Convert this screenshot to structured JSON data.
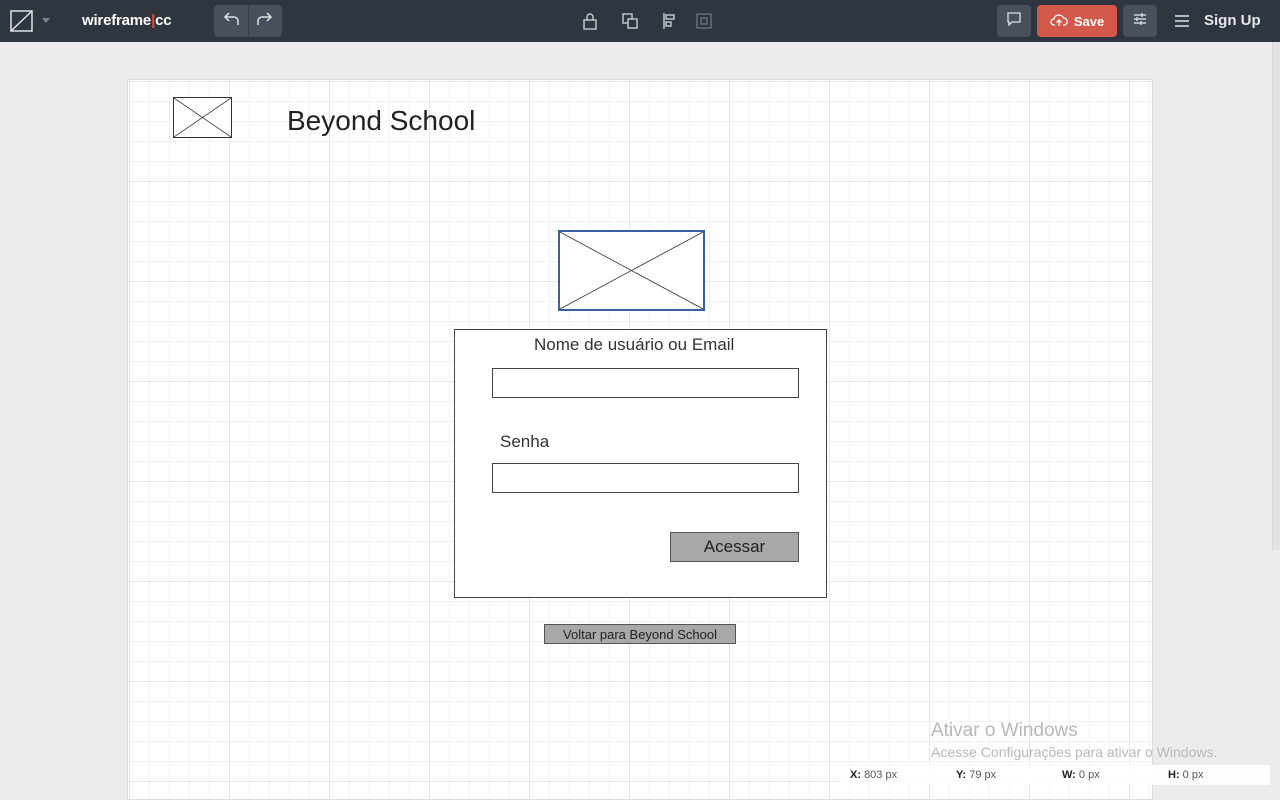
{
  "toolbar": {
    "brand_left": "wireframe",
    "brand_sep": "|",
    "brand_right": "cc",
    "save_label": "Save",
    "signup_label": "Sign Up",
    "icons": {
      "logo": "wireframe-logo-icon",
      "undo": "undo-icon",
      "redo": "redo-icon",
      "lock": "lock-icon",
      "duplicate": "duplicate-icon",
      "align": "align-icon",
      "group": "group-icon",
      "comment": "comment-icon",
      "save": "cloud-upload-icon",
      "settings": "settings-sliders-icon",
      "menu": "hamburger-menu-icon"
    },
    "colors": {
      "bar": "#2f3640",
      "save": "#d35a4a",
      "brand_accent": "#e04b3b"
    }
  },
  "wireframe": {
    "title": "Beyond School",
    "username_label": "Nome de usuário ou Email",
    "username_value": "",
    "password_label": "Senha",
    "password_value": "",
    "submit_label": "Acessar",
    "back_label": "Voltar para Beyond School"
  },
  "watermark": {
    "title": "Ativar o Windows",
    "subtitle": "Acesse Configurações para ativar o Windows."
  },
  "status": {
    "x_label": "X:",
    "x_value": "803 px",
    "y_label": "Y:",
    "y_value": "79 px",
    "w_label": "W:",
    "w_value": "0 px",
    "h_label": "H:",
    "h_value": "0 px"
  }
}
